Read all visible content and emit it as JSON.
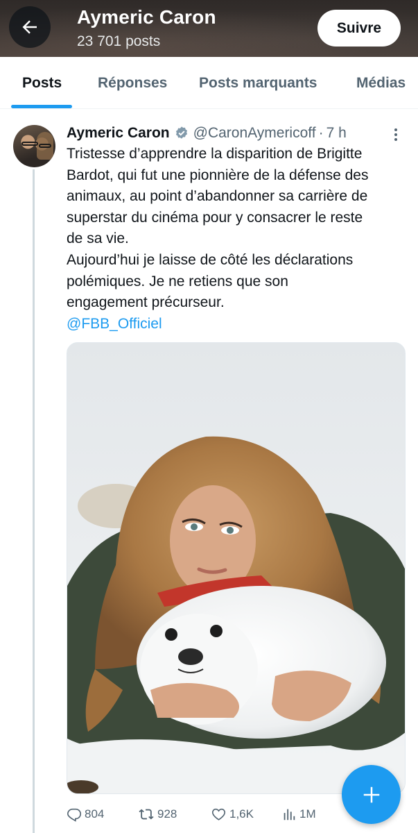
{
  "header": {
    "name": "Aymeric Caron",
    "posts_count": "23 701 posts",
    "follow_label": "Suivre"
  },
  "tabs": [
    {
      "label": "Posts",
      "active": true
    },
    {
      "label": "Réponses",
      "active": false
    },
    {
      "label": "Posts marquants",
      "active": false
    },
    {
      "label": "Médias",
      "active": false
    }
  ],
  "tweet": {
    "author": "Aymeric Caron",
    "handle": "@CaronAymericoff",
    "time": "7 h",
    "verified": true,
    "text_lines": [
      "Tristesse d’apprendre la disparition de Brigitte",
      "Bardot, qui fut une pionnière de la défense des",
      "animaux, au point d’abandonner sa carrière de",
      "superstar du cinéma pour y consacrer le reste",
      "de sa vie.",
      "Aujourd’hui je laisse de côté les déclarations",
      "polémiques. Je ne retiens que son",
      "engagement précurseur."
    ],
    "mention": "@FBB_Officiel",
    "media_icon": "photo-woman-with-seal-pup-on-snow",
    "actions": {
      "replies": "804",
      "reposts": "928",
      "likes": "1,6K",
      "views": "1M"
    }
  },
  "colors": {
    "accent": "#1d9bf0",
    "text_primary": "#0f1419",
    "text_secondary": "#536471"
  },
  "icons": {
    "back": "arrow-left-icon",
    "verified": "verified-badge-icon",
    "more": "more-vertical-icon",
    "reply": "reply-icon",
    "repost": "repost-icon",
    "like": "heart-icon",
    "views": "views-icon",
    "compose": "plus-icon"
  }
}
